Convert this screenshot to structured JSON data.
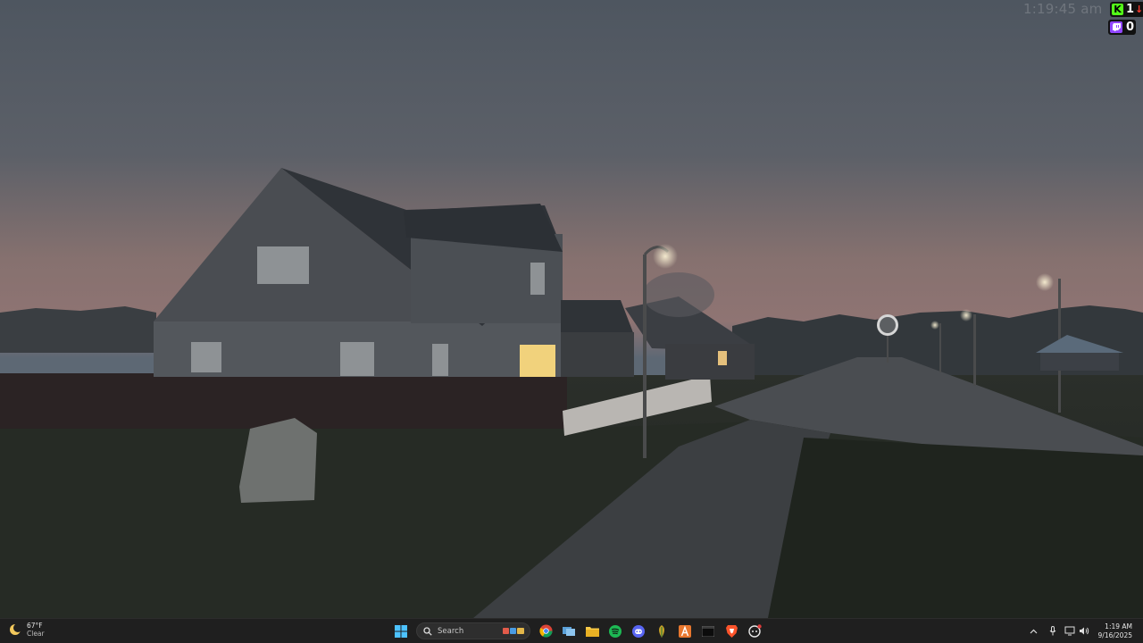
{
  "desktop": {
    "overlay": {
      "clock": "1:19:45 am",
      "kick_count": "1",
      "twitch_count": "0"
    }
  },
  "taskbar": {
    "weather": {
      "temp": "67°F",
      "condition": "Clear",
      "icon": "moon-icon"
    },
    "search": {
      "placeholder": "Search"
    },
    "apps": [
      {
        "name": "windows-start",
        "icon": "windows-logo-icon"
      },
      {
        "name": "chrome",
        "icon": "chrome-icon"
      },
      {
        "name": "task-view",
        "icon": "task-view-icon"
      },
      {
        "name": "file-explorer",
        "icon": "folder-icon"
      },
      {
        "name": "spotify",
        "icon": "spotify-icon"
      },
      {
        "name": "discord",
        "icon": "discord-icon"
      },
      {
        "name": "app-leaf",
        "icon": "leaf-icon"
      },
      {
        "name": "app-a",
        "icon": "a-app-icon"
      },
      {
        "name": "terminal",
        "icon": "terminal-icon"
      },
      {
        "name": "brave",
        "icon": "brave-lion-icon"
      },
      {
        "name": "app-bot",
        "icon": "bot-icon"
      }
    ],
    "tray": {
      "time": "1:19 AM",
      "date": "9/16/2025"
    },
    "colors": {
      "background": "#1f1f1f",
      "accent": "#0078d4"
    }
  }
}
